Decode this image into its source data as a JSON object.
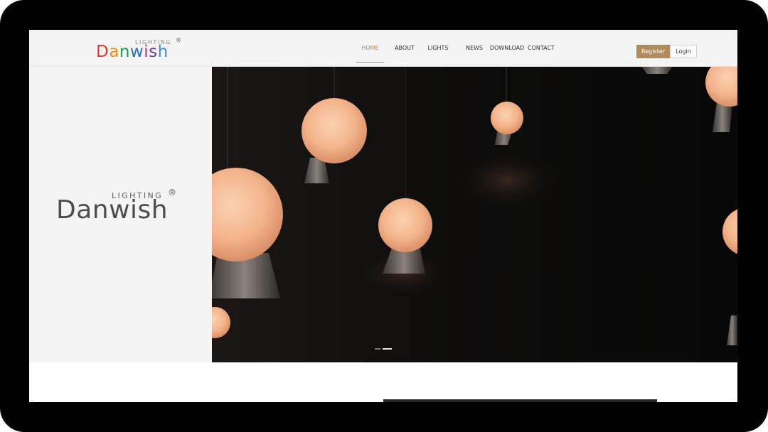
{
  "brand": {
    "name": "Danwish",
    "subtitle": "LIGHTING",
    "registered": "®",
    "letter_colors": [
      "#e23a2c",
      "#f08a1c",
      "#1d9b4f",
      "#1f6fc4",
      "#c2307a",
      "#6a3fa0",
      "#3a8fd6"
    ]
  },
  "nav": {
    "items": [
      {
        "label": "HOME",
        "active": true
      },
      {
        "label": "ABOUT",
        "active": false
      },
      {
        "label": "LIGHTS",
        "active": false
      },
      {
        "label": "NEWS",
        "active": false
      },
      {
        "label": "DOWNLOAD",
        "active": false
      },
      {
        "label": "CONTACT",
        "active": false
      }
    ]
  },
  "auth": {
    "register_label": "Register",
    "login_label": "Login"
  },
  "colors": {
    "accent": "#b48c5a",
    "header_bg": "#f4f4f4",
    "hero_bg": "#0c0b0a",
    "lamp_glow": "#f6b890"
  },
  "slider": {
    "slide_count": 2,
    "active_slide": 2
  }
}
